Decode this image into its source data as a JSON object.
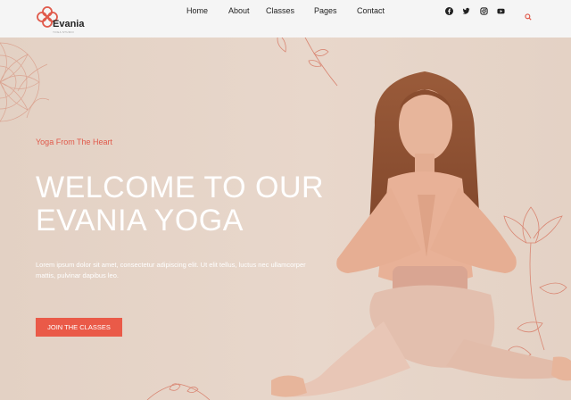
{
  "brand": {
    "name": "Evania",
    "tagline": "YOGA STUDIO"
  },
  "nav": [
    "Home",
    "About",
    "Classes",
    "Pages",
    "Contact"
  ],
  "social_icons": [
    "facebook-icon",
    "twitter-icon",
    "instagram-icon",
    "youtube-icon"
  ],
  "hero": {
    "kicker": "Yoga From The Heart",
    "title_line1": "WELCOME TO OUR",
    "title_line2": "EVANIA YOGA",
    "description": "Lorem ipsum dolor sit amet, consectetur adipiscing elit. Ut elit tellus, luctus nec ullamcorper mattis, pulvinar dapibus leo.",
    "cta": "JOIN THE CLASSES"
  },
  "colors": {
    "accent": "#ea5a48",
    "background": "#e6d4c7"
  }
}
